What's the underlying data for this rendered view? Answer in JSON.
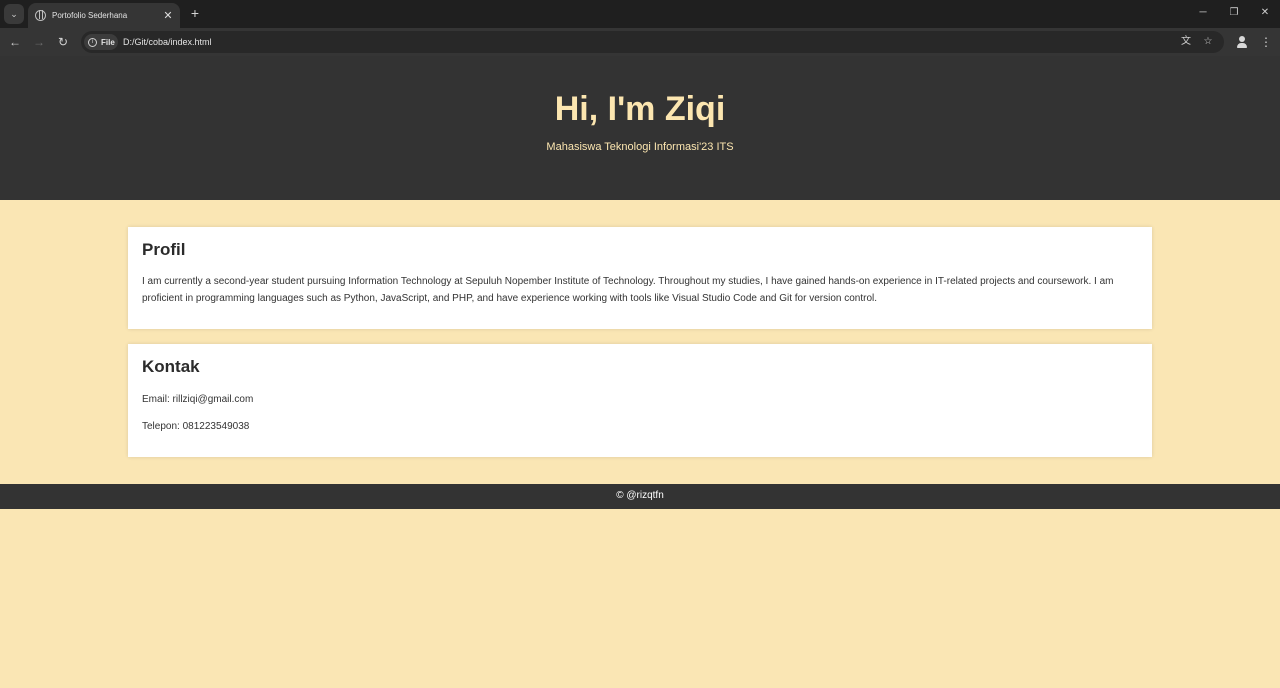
{
  "browser": {
    "tab_title": "Portofolio Sederhana",
    "tab_close": "✕",
    "new_tab": "+",
    "site_chip_label": "File",
    "url": "D:/Git/coba/index.html",
    "icons": [
      "tab-search-icon",
      "favicon-globe-icon",
      "back-arrow-icon",
      "forward-arrow-icon",
      "reload-icon",
      "info-icon",
      "translate-icon",
      "bookmark-star-icon",
      "profile-icon",
      "menu-kebab-icon",
      "minimize-icon",
      "restore-icon",
      "close-window-icon"
    ]
  },
  "header": {
    "title": "Hi, I'm Ziqi",
    "subtitle": "Mahasiswa Teknologi Informasi'23 ITS"
  },
  "profil": {
    "heading": "Profil",
    "text": "I am currently a second-year student pursuing Information Technology at Sepuluh Nopember Institute of Technology. Throughout my studies, I have gained hands-on experience in IT-related projects and coursework. I am proficient in programming languages such as Python, JavaScript, and PHP, and have experience working with tools like Visual Studio Code and Git for version control."
  },
  "kontak": {
    "heading": "Kontak",
    "email": "Email: rillziqi@gmail.com",
    "phone": "Telepon: 081223549038"
  },
  "footer": {
    "text": "© @rizqtfn"
  },
  "colors": {
    "page_background": "#fae6b4",
    "header_background": "#333333",
    "title_color": "#fce6b0",
    "card_background": "#ffffff"
  }
}
